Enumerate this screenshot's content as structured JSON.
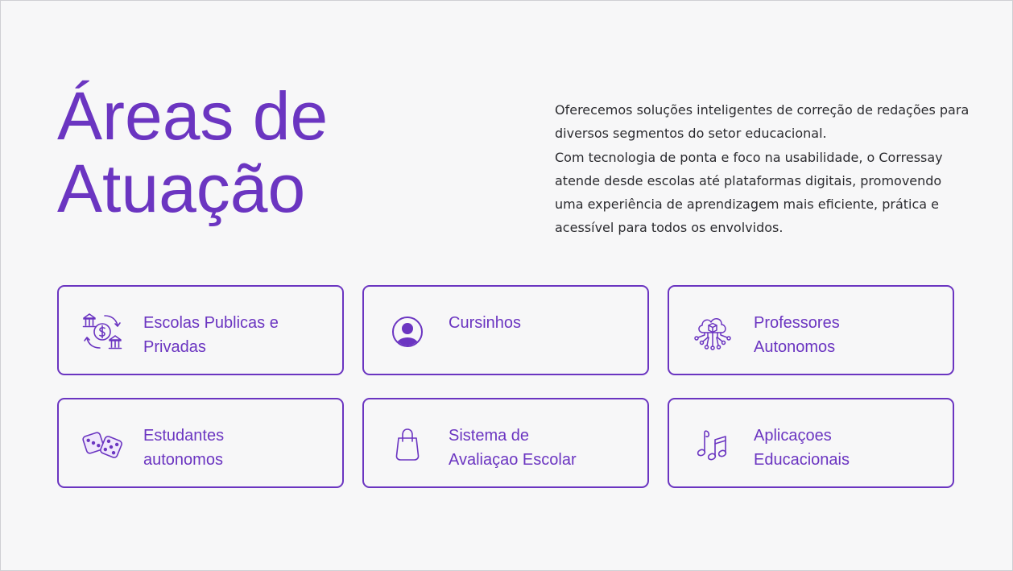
{
  "heading": {
    "line1": "Áreas de",
    "line2": "Atuação"
  },
  "intro": {
    "paragraph1": "Oferecemos soluções inteligentes de correção de redações para diversos segmentos do setor educacional.",
    "paragraph2": "Com tecnologia de ponta e foco na usabilidade, o Corressay atende desde escolas até plataformas digitais, promovendo uma experiência de aprendizagem mais eficiente, prática e acessível para todos os envolvidos."
  },
  "cards": [
    {
      "line1": "Escolas Publicas e",
      "line2": "Privadas",
      "icon": "bank-money-exchange-icon"
    },
    {
      "line1": "Cursinhos",
      "line2": "",
      "icon": "user-circle-icon"
    },
    {
      "line1": "Professores",
      "line2": "Autonomos",
      "icon": "cloud-network-icon"
    },
    {
      "line1": "Estudantes",
      "line2": "autonomos",
      "icon": "dice-icon"
    },
    {
      "line1": "Sistema de",
      "line2": "Avaliaçao Escolar",
      "icon": "shopping-bag-icon"
    },
    {
      "line1": "Aplicaçoes",
      "line2": "Educacionais",
      "icon": "music-notes-icon"
    }
  ],
  "colors": {
    "accent": "#6b35c1",
    "background": "#f7f7f8",
    "text": "#2b2b2f"
  }
}
